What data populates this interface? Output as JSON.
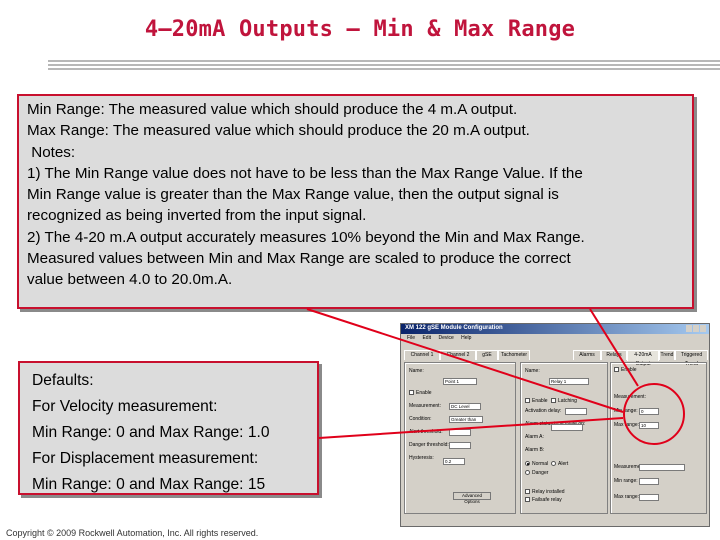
{
  "title": "4–20mA Outputs – Min & Max Range",
  "callout_main": {
    "lines": [
      "Min Range:  The measured value which should produce the 4 m.A output.",
      "Max Range:  The measured value which should produce the 20 m.A output.",
      " Notes:",
      "1) The Min Range value does not have to be less than the Max Range Value.  If the",
      "Min Range value is greater than the Max Range value, then the output signal is",
      "recognized as being inverted from the input signal.",
      "2) The 4-20 m.A output accurately measures 10% beyond the Min and Max Range.",
      "Measured values between Min and Max Range are scaled to produce the correct",
      "value between 4.0 to 20.0m.A."
    ]
  },
  "callout_defaults": {
    "lines": [
      "Defaults:",
      "For Velocity measurement:",
      "Min Range: 0 and Max Range: 1.0",
      "For Displacement measurement:",
      "Min Range: 0 and Max Range: 15"
    ]
  },
  "copyright": "Copyright © 2009 Rockwell Automation, Inc. All rights reserved.",
  "dialog": {
    "title": "XM 122 gSE Module Configuration",
    "menu": [
      "File",
      "Edit",
      "Device",
      "Help"
    ],
    "tabs": [
      "Channel 1",
      "Channel 2",
      "gSE",
      "Tachometer",
      "Alarms",
      "Relays",
      "4-20mA Output",
      "Trend",
      "Triggered Trend"
    ],
    "channel_fields": {
      "name_label": "Name:",
      "name_value": "Point 1",
      "measurement_label": "Measurement:",
      "measurement_value": "DC Level",
      "condition_label": "Condition:",
      "condition_value": "Greater than",
      "alert_threshold_label": "Alert threshold:",
      "danger_threshold_label": "Danger threshold:",
      "hysteresis_label": "Hysteresis:",
      "hysteresis_value": "0.2",
      "enable_label": "Enable",
      "advanced_button": "Advanced Options"
    },
    "relay_fields": {
      "name_label": "Name:",
      "name_value": "Relay 1",
      "enable_label": "Enable",
      "latching_label": "Latching",
      "activation_delay_label": "Activation delay:",
      "alarm_status_label": "Alarm status to activate on:",
      "alarm_a_label": "Alarm A:",
      "alarm_b_label": "Alarm B:",
      "normal_label": "Normal",
      "alert_label": "Alert",
      "danger_label": "Danger",
      "relay_installed_label": "Relay installed",
      "failsafe_label": "Failsafe relay"
    },
    "output_fields": {
      "enable_label": "Enable",
      "measurement_label": "Measurement:",
      "min_range_label": "Min range:",
      "max_range_label": "Max range:",
      "min_range_value": "0",
      "max_range_value": "10",
      "measurement2_label": "Measurement:",
      "min_range2_label": "Min range:",
      "max_range2_label": "Max range:"
    }
  },
  "colors": {
    "accent_red": "#c8102e",
    "callout_bg": "#dcdcdc",
    "dialog_bg": "#d4d0c8"
  }
}
